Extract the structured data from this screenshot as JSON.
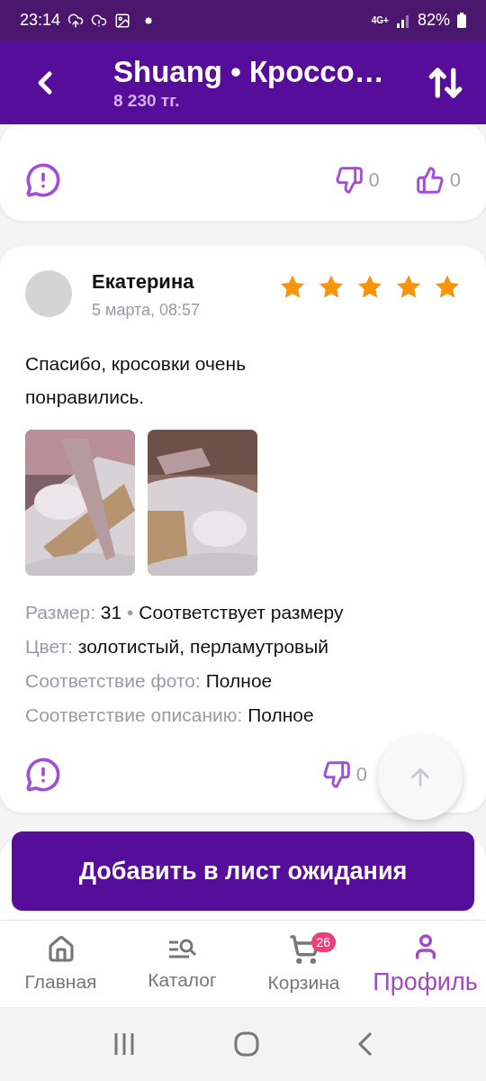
{
  "status_bar": {
    "time": "23:14",
    "network": "4G+",
    "battery": "82%"
  },
  "header": {
    "title": "Shuang • Кроссо…",
    "price": "8 230 тг."
  },
  "reviews": [
    {
      "dislikes": "0",
      "likes": "0"
    },
    {
      "author": "Екатерина",
      "date": "5 марта, 08:57",
      "stars": 5,
      "text": "Спасибо, кросовки очень понравились.",
      "photos": [
        {
          "kind": "picture"
        },
        {
          "kind": "picture"
        }
      ],
      "details": [
        {
          "label": "Размер:",
          "value": "31",
          "separator": "•",
          "note": "Соответствует размеру"
        },
        {
          "label": "Цвет:",
          "value": "золотистый, перламутровый"
        },
        {
          "label": "Соответствие фото:",
          "value": "Полное"
        },
        {
          "label": "Соответствие описанию:",
          "value": "Полное"
        }
      ],
      "dislikes": "0"
    },
    {
      "kind": "hidden"
    }
  ],
  "wishlist_button": "Добавить в лист ожидания",
  "bottom_nav": [
    {
      "kind": "home",
      "label": "Главная",
      "selected": false
    },
    {
      "kind": "catalog",
      "label": "Каталог",
      "selected": false
    },
    {
      "kind": "cart",
      "label": "Корзина",
      "badge": "26",
      "selected": false
    },
    {
      "kind": "profile",
      "label": "Профиль",
      "selected": true
    }
  ]
}
